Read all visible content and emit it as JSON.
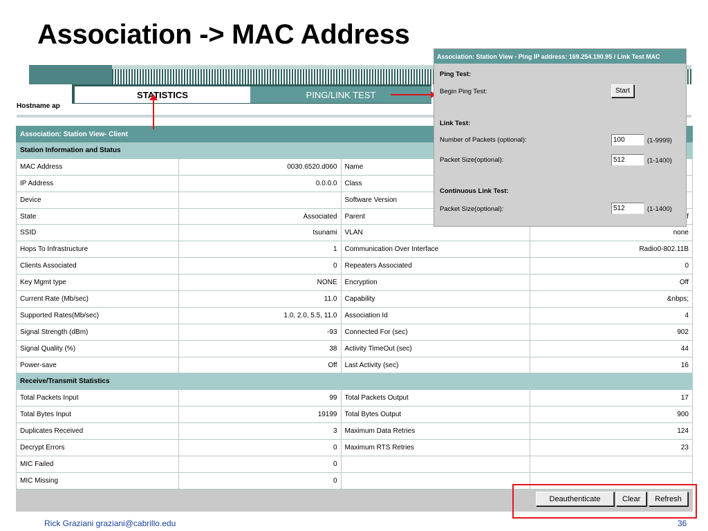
{
  "slide": {
    "title": "Association -> MAC Address",
    "author": "Rick Graziani  graziani@cabrillo.edu",
    "page": "36"
  },
  "tabs": [
    {
      "label": "STATISTICS"
    },
    {
      "label": "PING/LINK TEST"
    }
  ],
  "hostname": "Hostname  ap",
  "table": {
    "title": "Association: Station View- Client",
    "section1": "Station Information and Status",
    "station_rows": [
      [
        "MAC Address",
        "0030.6520.d060",
        "Name",
        ""
      ],
      [
        "IP Address",
        "0.0.0.0",
        "Class",
        ""
      ],
      [
        "Device",
        "",
        "Software Version",
        ""
      ],
      [
        "State",
        "Associated",
        "Parent",
        "f"
      ],
      [
        "SSID",
        "tsunami",
        "VLAN",
        "none"
      ],
      [
        "Hops To Infrastructure",
        "1",
        "Communication Over Interface",
        "Radio0-802.11B"
      ],
      [
        "Clients Associated",
        "0",
        "Repeaters Associated",
        "0"
      ],
      [
        "Key Mgmt type",
        "NONE",
        "Encryption",
        "Off"
      ],
      [
        "Current Rate (Mb/sec)",
        "11.0",
        "Capability",
        "&nbps;"
      ],
      [
        "Supported Rates(Mb/sec)",
        "1.0, 2.0, 5.5, 11.0",
        "Association Id",
        "4"
      ],
      [
        "Signal Strength (dBm)",
        "-93",
        "Connected For (sec)",
        "902"
      ],
      [
        "Signal Quality (%)",
        "38",
        "Activity TimeOut (sec)",
        "44"
      ],
      [
        "Power-save",
        "Off",
        "Last Activity (sec)",
        "16"
      ]
    ],
    "section2": "Receive/Transmit Statistics",
    "rx_rows": [
      [
        "Total Packets Input",
        "99",
        "Total Packets Output",
        "17"
      ],
      [
        "Total Bytes Input",
        "19199",
        "Total Bytes Output",
        "900"
      ],
      [
        "Duplicates Received",
        "3",
        "Maximum Data Retries",
        "124"
      ],
      [
        "Decrypt Errors",
        "0",
        "Maximum RTS Retries",
        "23"
      ],
      [
        "MIC Failed",
        "0",
        "",
        ""
      ],
      [
        "MIC Missing",
        "0",
        "",
        ""
      ]
    ]
  },
  "buttons": {
    "deauthenticate": "Deauthenticate",
    "clear": "Clear",
    "refresh": "Refresh"
  },
  "dialog": {
    "title": "Association: Station View - Ping IP address: 169.254.190.95 / Link Test MAC",
    "ping_heading": "Ping Test:",
    "begin_ping_label": "Begin Ping Test:",
    "start_button": "Start",
    "link_heading": "Link Test:",
    "num_packets_label": "Number of Packets (optional):",
    "num_packets_value": "100",
    "num_packets_range": "(1-9999)",
    "packet_size_label": "Packet Size(optional):",
    "packet_size_value": "512",
    "packet_size_range": "(1-1400)",
    "continuous_heading": "Continuous Link Test:",
    "cont_packet_size_label": "Packet Size(optional):",
    "cont_packet_size_value": "512",
    "cont_packet_size_range": "(1-1400)"
  },
  "colors": {
    "accent_teal": "#5f9a9a",
    "section_teal": "#a6cccc",
    "annotation_red": "#e0151b"
  }
}
